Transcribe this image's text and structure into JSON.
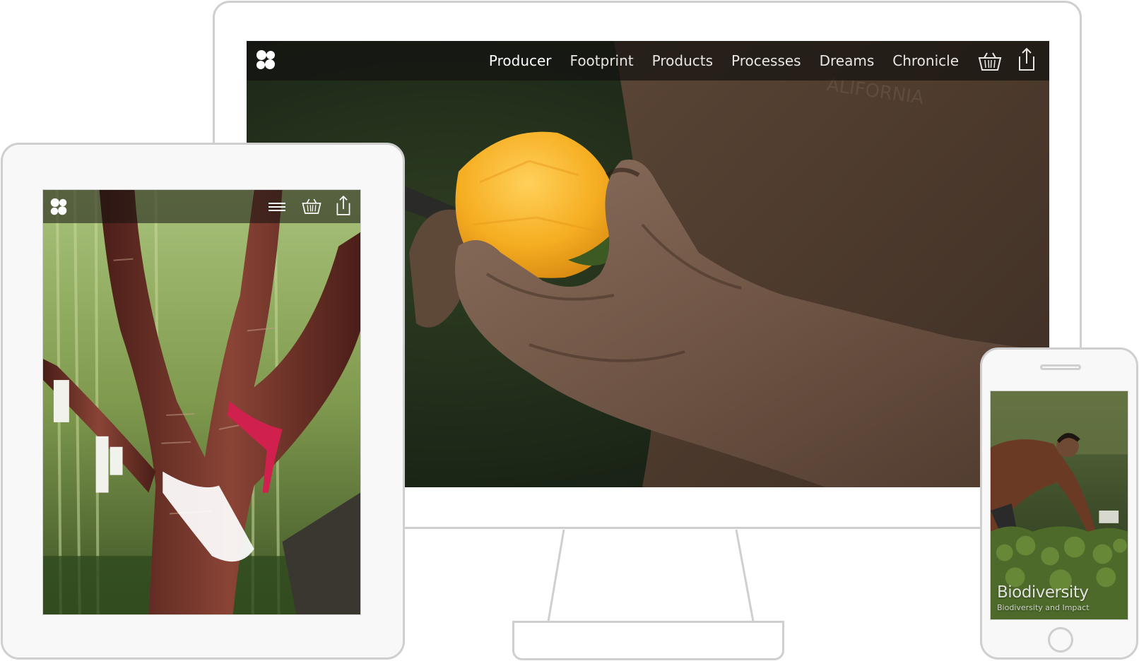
{
  "desktop": {
    "logo": "clover-logo-icon",
    "nav": {
      "items": [
        {
          "label": "Producer",
          "active": true
        },
        {
          "label": "Footprint",
          "active": false
        },
        {
          "label": "Products",
          "active": false
        },
        {
          "label": "Processes",
          "active": false
        },
        {
          "label": "Dreams",
          "active": false
        },
        {
          "label": "Chronicle",
          "active": false
        }
      ],
      "basket_icon": "basket-icon",
      "share_icon": "share-icon"
    },
    "hero_image": "hand-holding-peeled-orange-fruit"
  },
  "tablet": {
    "logo": "clover-logo-icon",
    "menu_icon": "hamburger-menu-icon",
    "basket_icon": "basket-icon",
    "share_icon": "share-icon",
    "hero_image": "red-bark-tree-with-ribbons"
  },
  "phone": {
    "hero_image": "man-tending-garden-plants",
    "caption_title": "Biodiversity",
    "caption_subtitle": "Biodiversity and Impact"
  },
  "colors": {
    "device_frame": "#cfcfcf",
    "nav_text": "#e9e6e1",
    "nav_bar": "#141210"
  }
}
